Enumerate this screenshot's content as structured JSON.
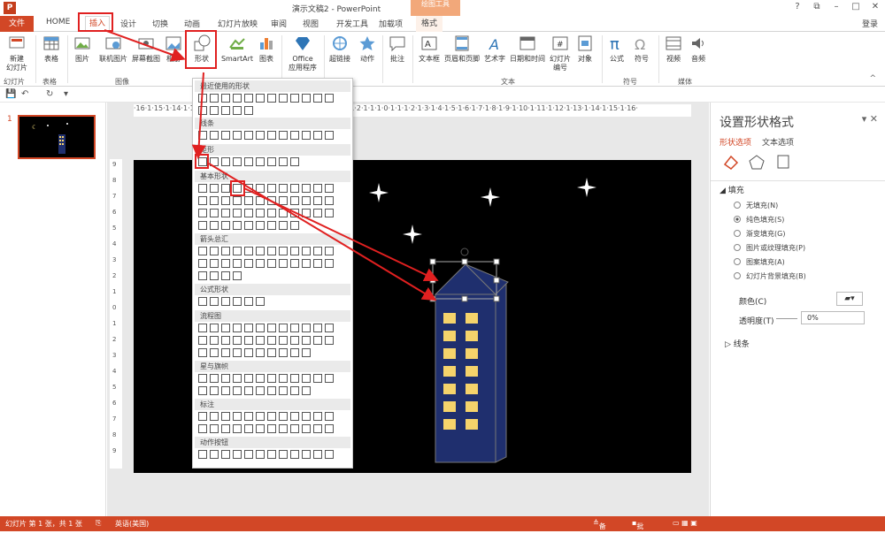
{
  "window": {
    "title": "演示文稿2 - PowerPoint",
    "context_tab_group": "绘图工具",
    "app_icon": "P"
  },
  "tabs": [
    "文件",
    "HOME",
    "插入",
    "设计",
    "切换",
    "动画",
    "幻灯片放映",
    "审阅",
    "视图",
    "开发工具",
    "加载项",
    "格式"
  ],
  "active_tab": "插入",
  "login": "登录",
  "ribbon": {
    "buttons": [
      "新建\n幻灯片",
      "表格",
      "图片",
      "联机图片",
      "屏幕截图",
      "相册",
      "形状",
      "SmartArt",
      "图表",
      "Office\n应用程序",
      "超链接",
      "动作",
      "批注",
      "文本框",
      "页眉和页脚",
      "艺术字",
      "日期和时间",
      "幻灯片\n编号",
      "对象",
      "公式",
      "符号",
      "视频",
      "音频"
    ],
    "groups": [
      "幻灯片",
      "表格",
      "图像",
      "文本",
      "符号",
      "媒体"
    ]
  },
  "shapes_menu": {
    "sections": [
      "最近使用的形状",
      "线条",
      "矩形",
      "基本形状",
      "箭头总汇",
      "公式形状",
      "流程图",
      "星与旗帜",
      "标注",
      "动作按钮"
    ]
  },
  "slide_panel": {
    "slide_number": "1"
  },
  "ruler": {
    "h": "·16·1·15·1·14·1·13·1·12·1·11·1·10·1·9·1·8·1·7·1·6·1·5·1·4·1·3·1·2·1·1·1·0·1·1·1·2·1·3·1·4·1·5·1·6·1·7·1·8·1·9·1·10·1·11·1·12·1·13·1·14·1·15·1·16·"
  },
  "format_pane": {
    "title": "设置形状格式",
    "tabs": [
      "形状选项",
      "文本选项"
    ],
    "fill_header": "填充",
    "fill_options": [
      "无填充(N)",
      "纯色填充(S)",
      "渐变填充(G)",
      "图片或纹理填充(P)",
      "图案填充(A)",
      "幻灯片背景填充(B)"
    ],
    "selected_fill": 1,
    "color_label": "颜色(C)",
    "transparency_label": "透明度(T)",
    "transparency_value": "0%",
    "line_header": "线条"
  },
  "status": {
    "slide_info": "幻灯片 第 1 张，共 1 张",
    "language": "英语(美国)",
    "notes": "备注",
    "comments": "批注"
  },
  "colors": {
    "accent": "#d24726",
    "building": "#1f2f6e",
    "window": "#f5d36b",
    "annotation": "#e02020"
  }
}
